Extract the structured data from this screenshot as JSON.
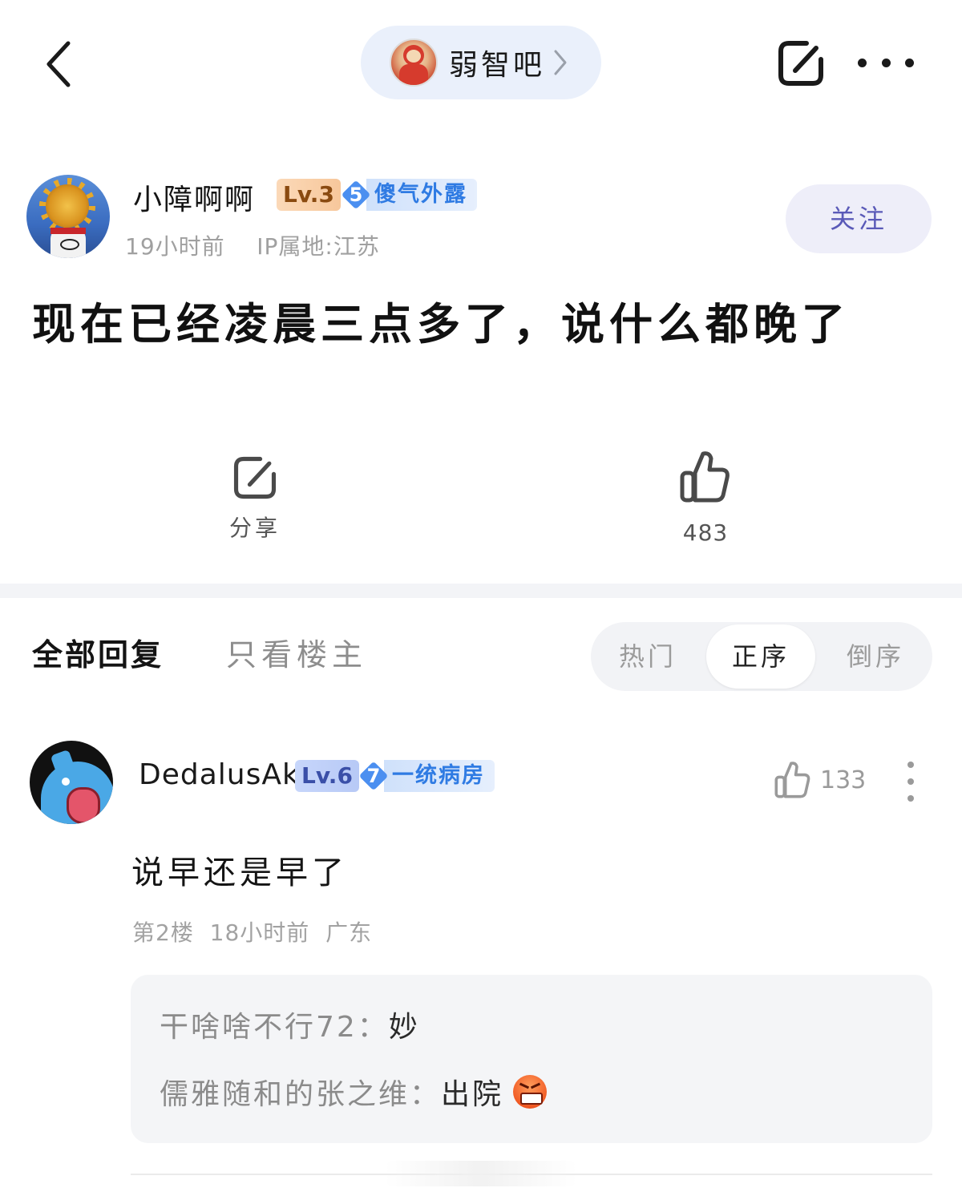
{
  "header": {
    "forum_name": "弱智吧"
  },
  "post": {
    "author": {
      "name": "小障啊啊",
      "level": "Lv.3",
      "honor_level": "5",
      "honor_title": "傻气外露",
      "time": "19小时前",
      "ip_location": "IP属地:江苏"
    },
    "follow_label": "关注",
    "title": "现在已经凌晨三点多了，说什么都晚了",
    "share_label": "分享",
    "like_count": "483"
  },
  "tabs": {
    "all_replies": "全部回复",
    "host_only": "只看楼主",
    "sort": {
      "hot": "热门",
      "asc": "正序",
      "desc": "倒序",
      "selected": "正序"
    }
  },
  "comments": [
    {
      "name": "DedalusAki",
      "level": "Lv.6",
      "honor_level": "7",
      "honor_title": "一统病房",
      "like_count": "133",
      "text": "说早还是早了",
      "floor": "第2楼",
      "time": "18小时前",
      "location": "广东",
      "sub_replies": [
        {
          "who": "干啥啥不行72：",
          "msg": "妙"
        },
        {
          "who": "儒雅随和的张之维：",
          "msg": "出院",
          "emoji": "angry-face-emoji"
        }
      ]
    }
  ],
  "colors": {
    "accent_blue": "#4b8ff0",
    "follow_text": "#5a5ab8",
    "meta_gray": "#a0a0a0"
  }
}
